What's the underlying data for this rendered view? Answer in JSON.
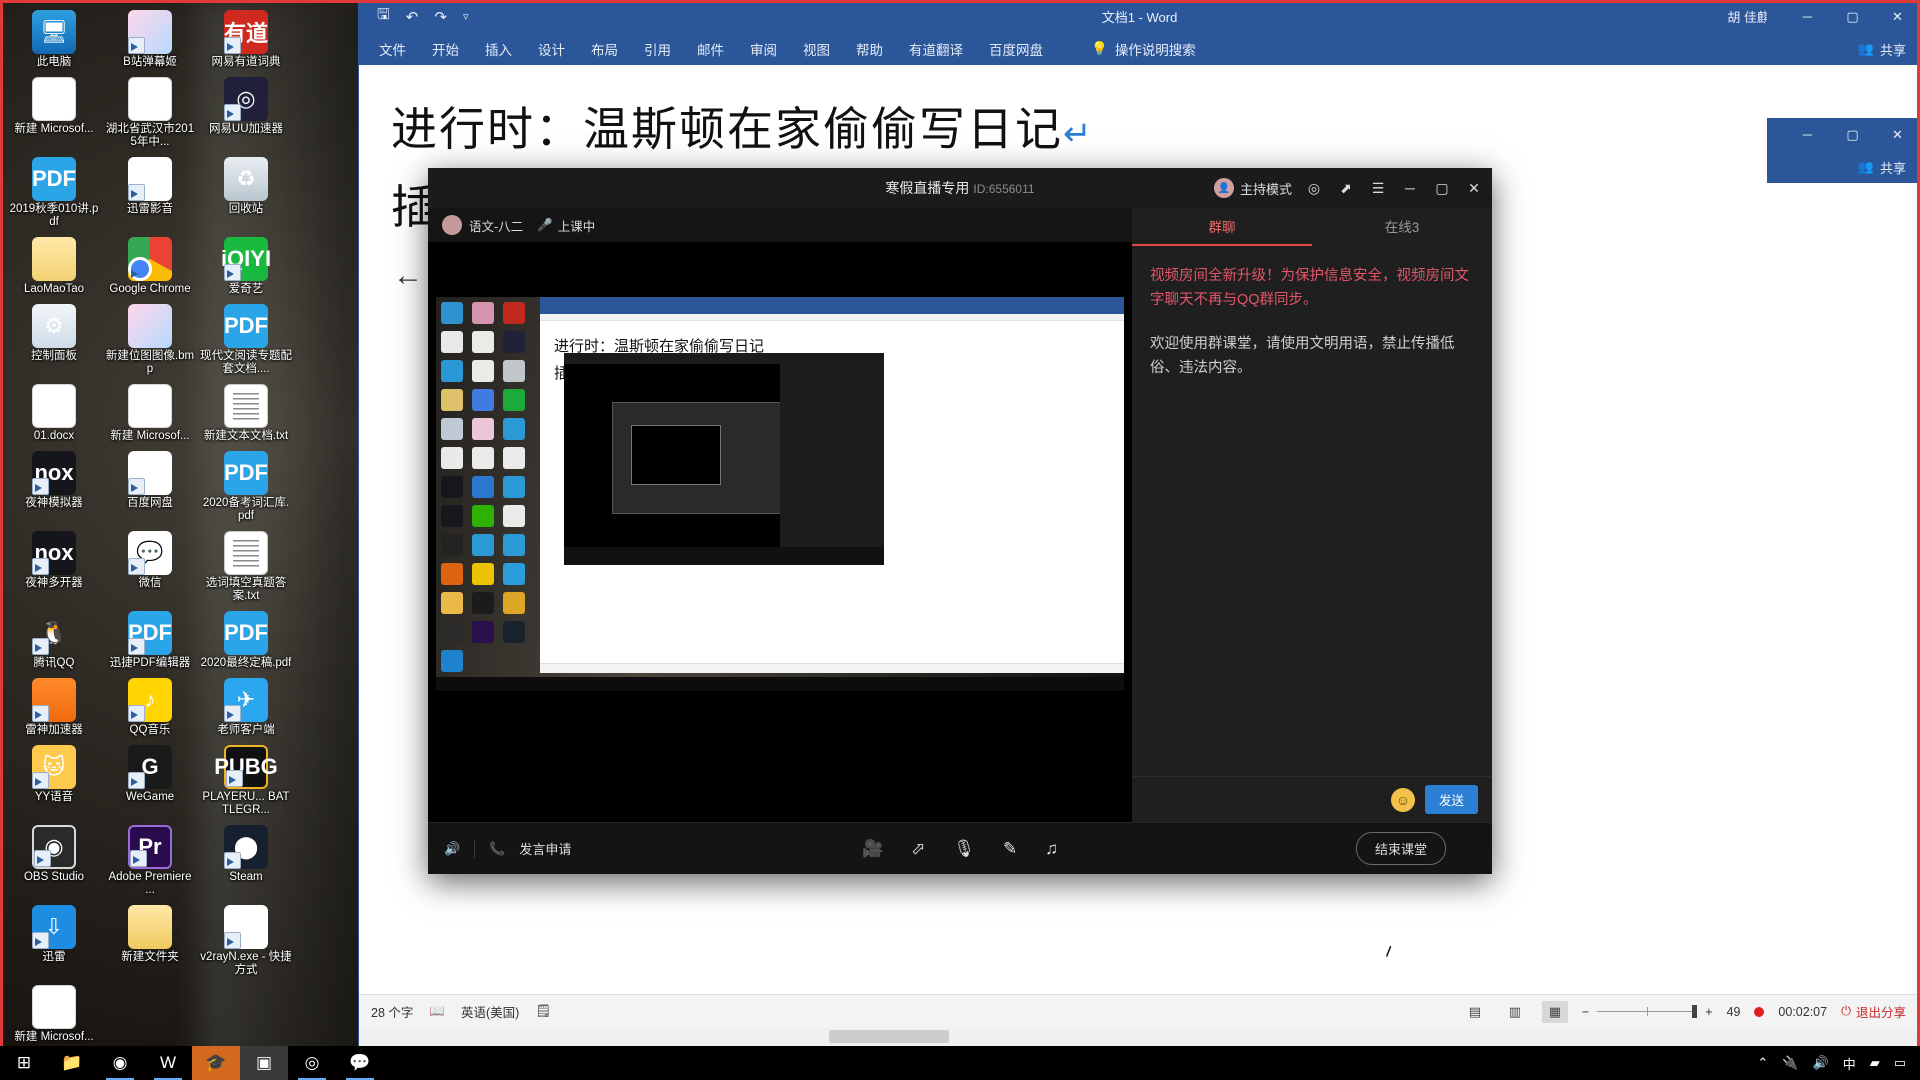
{
  "desktop": {
    "icons": [
      {
        "label": "此电脑",
        "icon": "this-pc-icon",
        "cls": "ic-pc",
        "glyph": "🖥",
        "shortcut": false
      },
      {
        "label": "B站弹幕姬",
        "icon": "bilibili-danmaku-icon",
        "cls": "ic-img",
        "glyph": "",
        "shortcut": true
      },
      {
        "label": "网易有道词典",
        "icon": "youdao-dict-icon",
        "cls": "ic-youdao",
        "glyph": "有道",
        "shortcut": true
      },
      {
        "label": "新建 Microsof...",
        "icon": "word-document-icon",
        "cls": "ic-word",
        "glyph": "W",
        "shortcut": false
      },
      {
        "label": "湖北省武汉市2015年中...",
        "icon": "word-document-icon",
        "cls": "ic-word",
        "glyph": "W",
        "shortcut": false
      },
      {
        "label": "网易UU加速器",
        "icon": "netease-uu-icon",
        "cls": "ic-uu",
        "glyph": "◎",
        "shortcut": true
      },
      {
        "label": "2019秋季010讲.pdf",
        "icon": "pdf-file-icon",
        "cls": "ic-pdf",
        "glyph": "PDF",
        "shortcut": false
      },
      {
        "label": "迅雷影音",
        "icon": "xunlei-player-icon",
        "cls": "ic-xunlei",
        "glyph": "▶",
        "shortcut": true
      },
      {
        "label": "回收站",
        "icon": "recycle-bin-icon",
        "cls": "ic-bin",
        "glyph": "♻",
        "shortcut": false
      },
      {
        "label": "LaoMaoTao",
        "icon": "folder-icon",
        "cls": "ic-folder",
        "glyph": "",
        "shortcut": false
      },
      {
        "label": "Google Chrome",
        "icon": "chrome-icon",
        "cls": "ic-chrome",
        "glyph": "",
        "shortcut": true
      },
      {
        "label": "爱奇艺",
        "icon": "iqiyi-icon",
        "cls": "ic-iqiyi",
        "glyph": "iQIYI",
        "shortcut": true
      },
      {
        "label": "控制面板",
        "icon": "control-panel-icon",
        "cls": "ic-cp",
        "glyph": "⚙",
        "shortcut": false
      },
      {
        "label": "新建位图图像.bmp",
        "icon": "bitmap-image-icon",
        "cls": "ic-img",
        "glyph": "",
        "shortcut": false
      },
      {
        "label": "现代文阅读专题配套文档....",
        "icon": "pdf-file-icon",
        "cls": "ic-pdf",
        "glyph": "PDF",
        "shortcut": false
      },
      {
        "label": "01.docx",
        "icon": "word-document-icon",
        "cls": "ic-word",
        "glyph": "W",
        "shortcut": false
      },
      {
        "label": "新建 Microsof...",
        "icon": "word-document-icon",
        "cls": "ic-word",
        "glyph": "W",
        "shortcut": false
      },
      {
        "label": "新建文本文档.txt",
        "icon": "text-file-icon",
        "cls": "ic-txt",
        "glyph": "",
        "shortcut": false
      },
      {
        "label": "夜神模拟器",
        "icon": "nox-emulator-icon",
        "cls": "ic-nox",
        "glyph": "nox",
        "shortcut": true
      },
      {
        "label": "百度网盘",
        "icon": "baidu-netdisk-icon",
        "cls": "ic-baidu",
        "glyph": "☁",
        "shortcut": true
      },
      {
        "label": "2020备考词汇库.pdf",
        "icon": "pdf-file-icon",
        "cls": "ic-pdf",
        "glyph": "PDF",
        "shortcut": false
      },
      {
        "label": "夜神多开器",
        "icon": "nox-multi-icon",
        "cls": "ic-nox",
        "glyph": "nox",
        "shortcut": true
      },
      {
        "label": "微信",
        "icon": "wechat-icon",
        "cls": "ic-wechat",
        "glyph": "💬",
        "shortcut": true
      },
      {
        "label": "选词填空真题答案.txt",
        "icon": "text-file-icon",
        "cls": "ic-txt",
        "glyph": "",
        "shortcut": false
      },
      {
        "label": "腾讯QQ",
        "icon": "tencent-qq-icon",
        "cls": "ic-qq",
        "glyph": "🐧",
        "shortcut": true
      },
      {
        "label": "迅捷PDF编辑器",
        "icon": "pdf-editor-icon",
        "cls": "ic-pdf",
        "glyph": "PDF",
        "shortcut": true
      },
      {
        "label": "2020最终定稿.pdf",
        "icon": "pdf-file-icon",
        "cls": "ic-pdf",
        "glyph": "PDF",
        "shortcut": false
      },
      {
        "label": "雷神加速器",
        "icon": "leishen-accelerator-icon",
        "cls": "ic-leishen",
        "glyph": "",
        "shortcut": true
      },
      {
        "label": "QQ音乐",
        "icon": "qq-music-icon",
        "cls": "ic-qqmusic",
        "glyph": "♪",
        "shortcut": true
      },
      {
        "label": "老师客户端",
        "icon": "teacher-client-icon",
        "cls": "ic-teacher",
        "glyph": "✈",
        "shortcut": true
      },
      {
        "label": "YY语音",
        "icon": "yy-voice-icon",
        "cls": "ic-yy",
        "glyph": "🐱",
        "shortcut": true
      },
      {
        "label": "WeGame",
        "icon": "wegame-icon",
        "cls": "ic-wegame",
        "glyph": "G",
        "shortcut": true
      },
      {
        "label": "PLAYERU... BATTLEGR...",
        "icon": "pubg-icon",
        "cls": "ic-pubg",
        "glyph": "PUBG",
        "shortcut": true
      },
      {
        "label": "OBS Studio",
        "icon": "obs-studio-icon",
        "cls": "ic-obs",
        "glyph": "◉",
        "shortcut": true
      },
      {
        "label": "Adobe Premiere ...",
        "icon": "adobe-premiere-icon",
        "cls": "ic-pr",
        "glyph": "Pr",
        "shortcut": true
      },
      {
        "label": "Steam",
        "icon": "steam-icon",
        "cls": "ic-steam",
        "glyph": "⬤",
        "shortcut": true
      },
      {
        "label": "迅雷",
        "icon": "xunlei-icon",
        "cls": "ic-xl2",
        "glyph": "⇩",
        "shortcut": true
      },
      {
        "label": "新建文件夹",
        "icon": "new-folder-icon",
        "cls": "ic-newfolder",
        "glyph": "",
        "shortcut": false
      },
      {
        "label": "v2rayN.exe - 快捷方式",
        "icon": "v2rayn-icon",
        "cls": "ic-v2ray",
        "glyph": "V",
        "shortcut": true
      },
      {
        "label": "新建 Microsof...",
        "icon": "word-document-icon",
        "cls": "ic-word",
        "glyph": "W",
        "shortcut": false
      }
    ]
  },
  "word": {
    "title": "文档1  -  Word",
    "user": "胡 佳麒",
    "quick_access": [
      "save-icon",
      "undo-icon",
      "redo-icon",
      "customize-qat-icon"
    ],
    "qat_glyphs": [
      "💾",
      "↶",
      "↷",
      "⌄"
    ],
    "tabs": [
      "文件",
      "开始",
      "插入",
      "设计",
      "布局",
      "引用",
      "邮件",
      "审阅",
      "视图",
      "帮助",
      "有道翻译",
      "百度网盘"
    ],
    "tell_me": "操作说明搜索",
    "share_label": "共享",
    "caption": {
      "minimize": "─",
      "maximize": "▢",
      "close": "✕"
    },
    "document": {
      "line1": "进行时：温斯顿在家偷偷写日记",
      "pilcrow": "↵",
      "line2": "插",
      "line3": "←"
    },
    "status": {
      "word_count": "28 个字",
      "proofing_icon": "proofing-icon",
      "language": "英语(美国)",
      "accessibility_icon": "accessibility-icon",
      "view_icons": [
        "read-mode-icon",
        "print-layout-icon",
        "web-layout-icon"
      ],
      "zoom_out": "−",
      "zoom_in": "+",
      "zoom_value": "49",
      "record_time": "00:02:07",
      "exit_share": "退出分享"
    }
  },
  "mini_windows": [
    {
      "name": "word-share-window-1",
      "share_label": "共享",
      "minimize": "─",
      "maximize": "▢",
      "close": "✕"
    },
    {
      "name": "word-share-window-2",
      "share_label": "共享",
      "minimize": "─",
      "maximize": "▢",
      "close": "✕"
    }
  ],
  "conference": {
    "title": "寒假直播专用",
    "room_id": "ID:6556011",
    "host_mode": "主持模式",
    "title_icons": [
      "settings-icon",
      "popout-icon",
      "menu-icon",
      "minimize-icon",
      "maximize-icon",
      "close-icon"
    ],
    "title_glyphs": [
      "◎",
      "⇱",
      "☰",
      "─",
      "▢",
      "✕"
    ],
    "class_name": "语文-八二",
    "class_status": "上课中",
    "chat": {
      "tabs": [
        {
          "label": "群聊",
          "active": true
        },
        {
          "label": "在线3",
          "active": false
        }
      ],
      "messages": [
        {
          "type": "warning",
          "text": "视频房间全新升级！为保护信息安全，视频房间文字聊天不再与QQ群同步。"
        },
        {
          "type": "info",
          "text": "欢迎使用群课堂，请使用文明用语，禁止传播低俗、违法内容。"
        }
      ],
      "emoji_icon": "emoji-icon",
      "send_label": "发送"
    },
    "footer": {
      "speaker_icon": "speaker-icon",
      "speak_request": "发言申请",
      "phone_icon": "phone-icon",
      "tools": [
        "camera-off-icon",
        "share-screen-icon",
        "microphone-icon",
        "whiteboard-icon",
        "music-icon"
      ],
      "tool_glyphs": [
        "📹",
        "⇱",
        "🎤",
        "✎",
        "♪"
      ],
      "end_class": "结束课堂"
    }
  },
  "taskbar": {
    "items": [
      {
        "name": "start-button",
        "glyph": "⊞",
        "state": "none"
      },
      {
        "name": "file-explorer-icon",
        "glyph": "📁",
        "state": "none"
      },
      {
        "name": "chrome-taskbar-icon",
        "glyph": "◉",
        "state": "run"
      },
      {
        "name": "word-taskbar-icon",
        "glyph": "W",
        "state": "run"
      },
      {
        "name": "class-client-taskbar-icon",
        "glyph": "🎓",
        "state": "act"
      },
      {
        "name": "screenshot-taskbar-icon",
        "glyph": "▣",
        "state": "act2"
      },
      {
        "name": "obs-taskbar-icon",
        "glyph": "◎",
        "state": "run"
      },
      {
        "name": "qq-classroom-taskbar-icon",
        "glyph": "💬",
        "state": "run"
      }
    ],
    "tray": [
      {
        "name": "show-hidden-icons",
        "glyph": "⌃"
      },
      {
        "name": "usb-icon",
        "glyph": "🔌"
      },
      {
        "name": "volume-icon",
        "glyph": "🔊"
      },
      {
        "name": "ime-icon",
        "glyph": "中"
      },
      {
        "name": "network-icon",
        "glyph": "▰"
      },
      {
        "name": "action-center-icon",
        "glyph": "▭"
      }
    ]
  }
}
